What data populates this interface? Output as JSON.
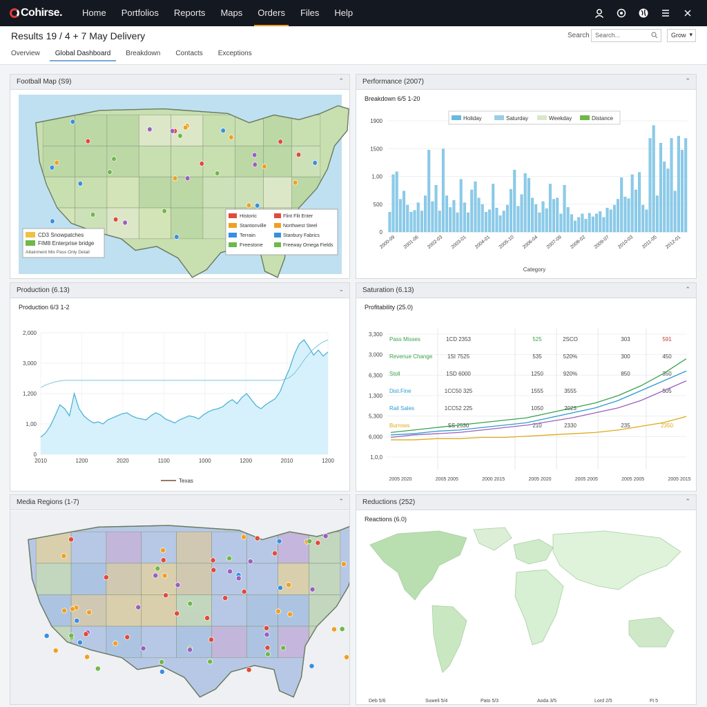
{
  "app": {
    "logo": "Cohirse."
  },
  "nav": {
    "items": [
      "Home",
      "Portfolios",
      "Reports",
      "Maps",
      "Orders",
      "Files",
      "Help"
    ],
    "active_index": 4
  },
  "header": {
    "title": "Results 19 / 4 + 7 May Delivery",
    "search_label": "Search",
    "search_placeholder": "Search...",
    "sort_value": "Grow"
  },
  "tabs": {
    "items": [
      "Overview",
      "Global Dashboard",
      "Breakdown",
      "Contacts",
      "Exceptions"
    ],
    "active_index": 1
  },
  "panels": {
    "p1": {
      "title": "Football Map (S9)"
    },
    "p2": {
      "title": "Performance (2007)",
      "subtitle": "Breakdown 6/5 1-20"
    },
    "p3": {
      "title": "Production (6.13)",
      "subtitle": "Production 6/3 1-2"
    },
    "p4": {
      "title": "Saturation (6.13)",
      "subtitle": "Profitability (25.0)"
    },
    "p5": {
      "title": "Media Regions (1-7)"
    },
    "p6": {
      "title": "Reductions (252)",
      "subtitle": "Reactions (6.0)"
    }
  },
  "map1": {
    "legend_left": [
      {
        "label": "CD3 Snowpatches",
        "color": "#f0c040"
      },
      {
        "label": "FIM8 Enterprise bridge",
        "color": "#6fb84a"
      }
    ],
    "legend_left_footer": "Attainment Mix Pass Only Detail",
    "legend_right": [
      {
        "label": "Historic",
        "label2": "Flint Flit Enter",
        "color": "#e24a3a"
      },
      {
        "label": "Stantonville",
        "label2": "Northwest Steel",
        "color": "#f0a020"
      },
      {
        "label": "Terrain",
        "label2": "Stanbury Fabrics",
        "color": "#3a8ee0"
      },
      {
        "label": "Freestone",
        "label2": "Freeway Omega Fields",
        "color": "#6fb84a"
      }
    ]
  },
  "palette": {
    "ocean": "#bfe0f0",
    "land": "#c8dfb0",
    "bar": "#8ccbe8",
    "line": "#4fb3d6",
    "area": "#d6f1fb"
  },
  "chart_data": [
    {
      "type": "bar",
      "legend": [
        "Holiday",
        "Saturday",
        "Weekday",
        "Distance"
      ],
      "legend_colors": [
        "#6ab8e0",
        "#9ccde6",
        "#d9e8c8",
        "#6fb84a"
      ],
      "yticks": [
        "1900",
        "1500",
        "1,00",
        "500",
        "0"
      ],
      "xticks": [
        "2000-09",
        "2001-06",
        "2002-03",
        "2003-01",
        "2004-01",
        "2005-10",
        "2006-04",
        "2007-09",
        "2008-02",
        "2009-07",
        "2010-03",
        "2011-05",
        "2012-01"
      ],
      "xlabel": "Category",
      "ylim": [
        0,
        1900
      ],
      "values": [
        340,
        980,
        1030,
        560,
        700,
        460,
        340,
        370,
        500,
        360,
        620,
        1400,
        520,
        800,
        360,
        1420,
        620,
        420,
        540,
        330,
        900,
        500,
        330,
        720,
        860,
        580,
        470,
        340,
        380,
        820,
        410,
        280,
        360,
        460,
        730,
        1060,
        440,
        640,
        1000,
        920,
        580,
        470,
        330,
        520,
        400,
        820,
        560,
        580,
        310,
        800,
        420,
        300,
        190,
        250,
        310,
        220,
        320,
        260,
        310,
        350,
        250,
        410,
        380,
        460,
        560,
        930,
        600,
        570,
        980,
        720,
        1020,
        460,
        380,
        1600,
        1820,
        620,
        1520,
        1200,
        1080,
        1600,
        700,
        1640,
        1400,
        1600
      ]
    },
    {
      "type": "area",
      "yticks": [
        "2,000",
        "3,000",
        "1,200",
        "1,00",
        "0"
      ],
      "xticks": [
        "2010",
        "1200",
        "2020",
        "1100",
        "1000",
        "1200",
        "2010",
        "1200"
      ],
      "legend": [
        "Texas"
      ],
      "ylim": [
        0,
        2400
      ],
      "x": [
        0,
        1,
        2,
        3,
        4,
        5,
        6,
        7,
        8,
        9,
        10,
        11,
        12,
        13,
        14,
        15,
        16,
        17,
        18,
        19,
        20,
        21,
        22,
        23,
        24,
        25,
        26,
        27,
        28,
        29,
        30,
        31,
        32,
        33,
        34,
        35,
        36,
        37,
        38,
        39,
        40,
        41,
        42,
        43,
        44,
        45,
        46,
        47,
        48,
        49,
        50,
        51,
        52,
        53,
        54,
        55,
        56,
        57,
        58,
        59,
        60
      ],
      "values": [
        340,
        420,
        560,
        760,
        980,
        900,
        760,
        1200,
        900,
        760,
        680,
        620,
        640,
        600,
        680,
        720,
        760,
        800,
        820,
        760,
        720,
        700,
        680,
        760,
        820,
        780,
        700,
        660,
        620,
        680,
        720,
        760,
        740,
        700,
        780,
        840,
        880,
        900,
        940,
        1020,
        1080,
        1000,
        1120,
        1200,
        1080,
        960,
        900,
        980,
        1040,
        1100,
        1240,
        1480,
        1700,
        1980,
        2180,
        2260,
        2120,
        1960,
        2060,
        1940,
        2020
      ],
      "secondary": [
        1320,
        1370,
        1400,
        1430,
        1450,
        1460,
        1460,
        1460,
        1460,
        1460,
        1460,
        1460,
        1460,
        1460,
        1460,
        1460,
        1460,
        1460,
        1460,
        1460,
        1460,
        1460,
        1460,
        1460,
        1460,
        1460,
        1460,
        1460,
        1460,
        1460,
        1460,
        1460,
        1460,
        1460,
        1460,
        1460,
        1460,
        1460,
        1460,
        1460,
        1460,
        1460,
        1460,
        1460,
        1460,
        1460,
        1460,
        1460,
        1460,
        1460,
        1460,
        1480,
        1520,
        1600,
        1720,
        1860,
        1980,
        2080,
        2160,
        2220,
        2260
      ]
    },
    {
      "type": "line",
      "yticks": [
        "3,300",
        "3,000",
        "6,300",
        "1,300",
        "5,300",
        "6,000",
        "1,0,0"
      ],
      "xticks": [
        "2005 2020",
        "2005 2005",
        "2000 2015",
        "2005 2020",
        "2005 2005",
        "2005 2005",
        "2005 2015"
      ],
      "rows": [
        {
          "label": "Pass Misses",
          "color": "#3aa14a",
          "cells": [
            "1CD 2353",
            "525",
            "2SCO",
            "303",
            "591"
          ],
          "cell_colors": [
            "#444",
            "#3aa14a",
            "#444",
            "#444",
            "#c0392b"
          ]
        },
        {
          "label": "Revenue Change",
          "color": "#3aa14a",
          "cells": [
            "1SI 7525",
            "535",
            "520%",
            "300",
            "450"
          ],
          "cell_colors": [
            "#444",
            "#444",
            "#444",
            "#444",
            "#444"
          ]
        },
        {
          "label": "Stoll",
          "color": "#3aa14a",
          "cells": [
            "1SD 6000",
            "1250",
            "920%",
            "850",
            "350"
          ],
          "cell_colors": [
            "#444",
            "#444",
            "#444",
            "#444",
            "#444"
          ]
        },
        {
          "label": "Dist.Fine",
          "color": "#2a9ad0",
          "cells": [
            "1CC50 325",
            "1555",
            "3555",
            "",
            "505"
          ],
          "cell_colors": [
            "#444",
            "#444",
            "#444",
            "#444",
            "#444"
          ]
        },
        {
          "label": "Rail Sales",
          "color": "#2a9ad0",
          "cells": [
            "1CC52 225",
            "1050",
            "2023",
            "",
            ""
          ],
          "cell_colors": [
            "#444",
            "#444",
            "#444",
            "#444",
            "#444"
          ]
        },
        {
          "label": "Burrows",
          "color": "#e0a81a",
          "cells": [
            "SS 2530",
            "210",
            "2330",
            "235",
            "2350"
          ],
          "cell_colors": [
            "#444",
            "#444",
            "#444",
            "#444",
            "#e0a81a"
          ]
        }
      ],
      "series": [
        {
          "name": "Pass Misses",
          "color": "#3aa14a",
          "values": [
            20,
            22,
            24,
            26,
            28,
            30,
            32,
            36,
            40,
            44,
            50,
            58,
            68,
            80
          ]
        },
        {
          "name": "Dist.Fine",
          "color": "#2a9ad0",
          "values": [
            18,
            19,
            21,
            22,
            24,
            26,
            28,
            32,
            36,
            40,
            46,
            54,
            62,
            70
          ]
        },
        {
          "name": "Rail Sales",
          "color": "#9b5fc0",
          "values": [
            16,
            18,
            19,
            20,
            22,
            24,
            26,
            29,
            32,
            36,
            40,
            46,
            54,
            62
          ]
        },
        {
          "name": "Burrows",
          "color": "#e0a81a",
          "values": [
            14,
            14,
            15,
            15,
            16,
            16,
            17,
            18,
            19,
            20,
            22,
            25,
            28,
            33
          ]
        }
      ],
      "ylim": [
        0,
        100
      ]
    }
  ],
  "world_ticks": [
    "Deb 5/6",
    "Suweli 5/4",
    "Pato 5/3",
    "Aoda 3/5",
    "Lord 2/5",
    "Ft 5"
  ]
}
